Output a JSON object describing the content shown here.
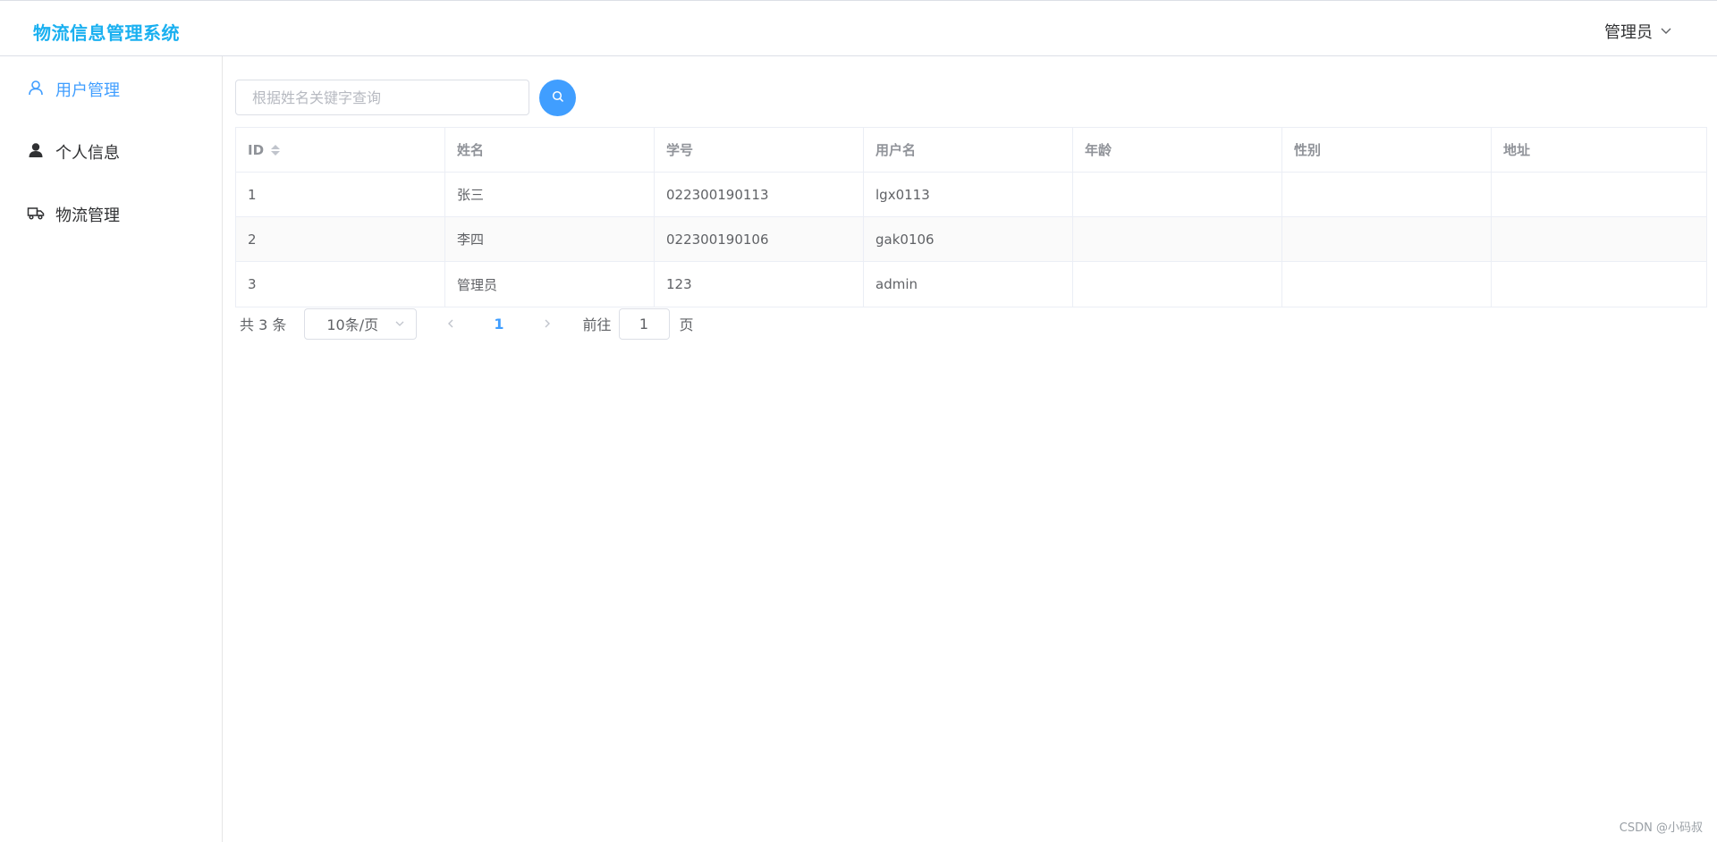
{
  "header": {
    "app_title": "物流信息管理系统",
    "user_menu_label": "管理员"
  },
  "sidebar": {
    "items": [
      {
        "label": "用户管理",
        "icon": "user-outline-icon",
        "active": true
      },
      {
        "label": "个人信息",
        "icon": "user-filled-icon",
        "active": false
      },
      {
        "label": "物流管理",
        "icon": "truck-icon",
        "active": false
      }
    ]
  },
  "search": {
    "placeholder": "根据姓名关键字查询",
    "value": ""
  },
  "table": {
    "columns": [
      "ID",
      "姓名",
      "学号",
      "用户名",
      "年龄",
      "性别",
      "地址"
    ],
    "rows": [
      [
        "1",
        "张三",
        "022300190113",
        "lgx0113",
        "",
        "",
        ""
      ],
      [
        "2",
        "李四",
        "022300190106",
        "gak0106",
        "",
        "",
        ""
      ],
      [
        "3",
        "管理员",
        "123",
        "admin",
        "",
        "",
        ""
      ]
    ]
  },
  "pagination": {
    "total_text": "共 3 条",
    "page_size": "10条/页",
    "current_page": "1",
    "goto_label": "前往",
    "goto_value": "1",
    "goto_suffix": "页"
  },
  "watermark": "CSDN @小码叔",
  "colors": {
    "brand": "#1ab0f0",
    "accent": "#409eff"
  }
}
